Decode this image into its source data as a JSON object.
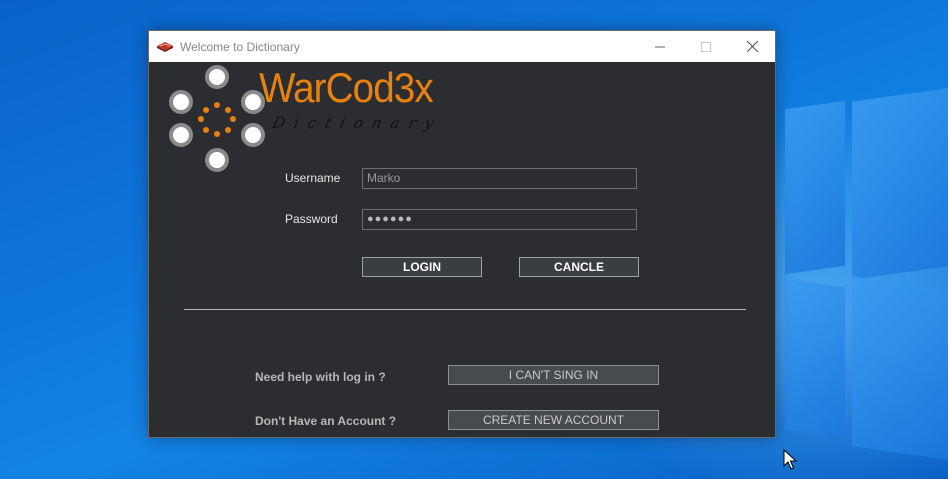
{
  "window": {
    "title": "Welcome to Dictionary",
    "icon": "red-book-icon",
    "controls": {
      "minimize": "minimize-icon",
      "maximize": "maximize-icon",
      "close": "close-icon"
    }
  },
  "brand": {
    "name": "WarCod3x",
    "subtitle": "Dictionary"
  },
  "login_form": {
    "username_label": "Username",
    "username_value": "Marko",
    "password_label": "Password",
    "password_value": "●●●●●●",
    "login_button": "LOGIN",
    "cancel_button": "CANCLE"
  },
  "help": {
    "question": "Need help with log in ?",
    "button": "I CAN'T SING IN"
  },
  "signup": {
    "question": "Don't Have an Account ?",
    "button": "CREATE NEW ACCOUNT"
  },
  "colors": {
    "accent": "#e8820c",
    "window_bg": "#2b2d31",
    "desktop": "#0e74d8"
  }
}
